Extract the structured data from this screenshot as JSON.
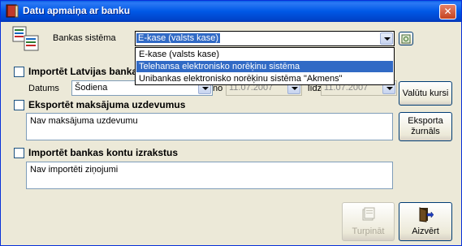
{
  "window": {
    "title": "Datu apmaiņa ar banku",
    "close_glyph": "✕"
  },
  "bank": {
    "label": "Bankas sistēma",
    "selected": "E-kase (valsts kase)",
    "options": [
      "E-kase (valsts kase)",
      "Telehansa elektronisko norēķinu sistēma",
      "Unibankas elektronisko norēķinu sistēma \"Akmens\""
    ]
  },
  "import_rates": {
    "checkbox_label": "Importēt Latvijas banka",
    "date_label": "Datums",
    "date_value": "Šodiena",
    "from_label": "no",
    "from_value": "11.07.2007",
    "to_label": "līdz",
    "to_value": "11.07.2007"
  },
  "export_payments": {
    "checkbox_label": "Eksportēt maksājuma uzdevumus",
    "status": "Nav maksājuma uzdevumu"
  },
  "import_statements": {
    "checkbox_label": "Importēt bankas kontu izrakstus",
    "status": "Nav importēti ziņojumi"
  },
  "buttons": {
    "currency_rates": "Valūtu kursi",
    "export_log_line1": "Eksporta",
    "export_log_line2": "žurnāls",
    "continue": "Turpināt",
    "exit": "Aizvērt"
  },
  "colors": {
    "accent": "#316ac5",
    "titlebar": "#0058e6",
    "close": "#c5431f"
  }
}
